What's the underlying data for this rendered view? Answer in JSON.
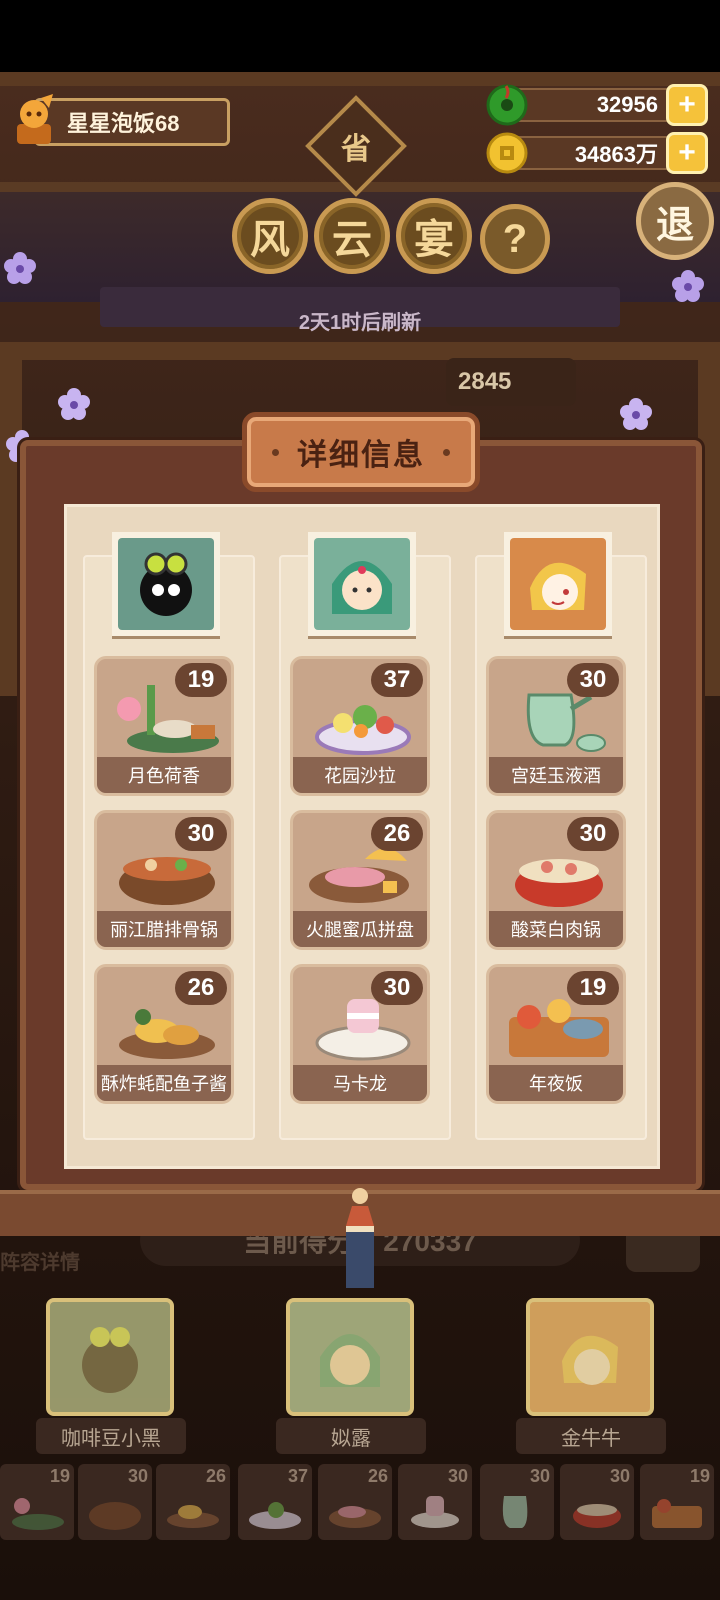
{
  "profile": {
    "name": "星星泡饭68"
  },
  "currency": {
    "gems": "32956",
    "coins": "34863万"
  },
  "header": {
    "province": "省",
    "feast_chars": [
      "风",
      "云",
      "宴"
    ],
    "help": "?",
    "exit": "退",
    "refresh": "2天1时后刷新",
    "score_partial": "2845"
  },
  "panel": {
    "title": "详细信息",
    "dishes": [
      {
        "name": "月色荷香",
        "count": "19"
      },
      {
        "name": "花园沙拉",
        "count": "37"
      },
      {
        "name": "宫廷玉液酒",
        "count": "30"
      },
      {
        "name": "丽江腊排骨锅",
        "count": "30"
      },
      {
        "name": "火腿蜜瓜拼盘",
        "count": "26"
      },
      {
        "name": "酸菜白肉锅",
        "count": "30"
      },
      {
        "name": "酥炸蚝配鱼子酱",
        "count": "26"
      },
      {
        "name": "马卡龙",
        "count": "30"
      },
      {
        "name": "年夜饭",
        "count": "19"
      }
    ]
  },
  "lower": {
    "lineup_label": "阵容详情",
    "score_text": "当前得分：270337",
    "team": [
      "咖啡豆小黑",
      "姒露",
      "金牛牛"
    ],
    "strip_counts": [
      "19",
      "30",
      "26",
      "37",
      "26",
      "30",
      "30",
      "30",
      "19"
    ]
  },
  "colors": {
    "panel": "#6a3a2a",
    "paper": "#e9d8bf",
    "card": "#c8a58a",
    "label": "#8a6450",
    "accent": "#f5c23a"
  }
}
